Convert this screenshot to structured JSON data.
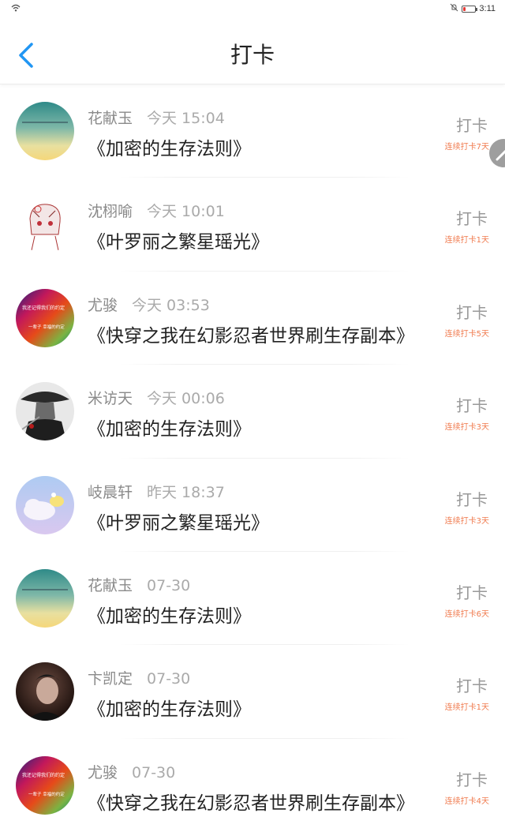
{
  "status_bar": {
    "time": "3:11"
  },
  "header": {
    "title": "打卡"
  },
  "items": [
    {
      "user": "花献玉",
      "time": "今天 15:04",
      "book": "《加密的生存法则》",
      "check_label": "打卡",
      "streak": "连续打卡7天",
      "avatar": "avatar-landscape-gradient"
    },
    {
      "user": "沈栩喻",
      "time": "今天 10:01",
      "book": "《叶罗丽之繁星瑶光》",
      "check_label": "打卡",
      "streak": "连续打卡1天",
      "avatar": "avatar-anime-sketch"
    },
    {
      "user": "尤骏",
      "time": "今天 03:53",
      "book": "《快穿之我在幻影忍者世界刷生存副本》",
      "check_label": "打卡",
      "streak": "连续打卡5天",
      "avatar": "avatar-rainbow-text"
    },
    {
      "user": "米访天",
      "time": "今天 00:06",
      "book": "《加密的生存法则》",
      "check_label": "打卡",
      "streak": "连续打卡3天",
      "avatar": "avatar-swordsman-bw"
    },
    {
      "user": "岐晨轩",
      "time": "昨天 18:37",
      "book": "《叶罗丽之繁星瑶光》",
      "check_label": "打卡",
      "streak": "连续打卡3天",
      "avatar": "avatar-cloud-cartoon"
    },
    {
      "user": "花献玉",
      "time": "07-30",
      "book": "《加密的生存法则》",
      "check_label": "打卡",
      "streak": "连续打卡6天",
      "avatar": "avatar-landscape-gradient"
    },
    {
      "user": "卞凯定",
      "time": "07-30",
      "book": "《加密的生存法则》",
      "check_label": "打卡",
      "streak": "连续打卡1天",
      "avatar": "avatar-dark-portrait"
    },
    {
      "user": "尤骏",
      "time": "07-30",
      "book": "《快穿之我在幻影忍者世界刷生存副本》",
      "check_label": "打卡",
      "streak": "连续打卡4天",
      "avatar": "avatar-rainbow-text"
    }
  ],
  "avatar_texts": {
    "rainbow_line1": "我还记得我们的约定",
    "rainbow_line2": "一辈子 幸福的约定"
  },
  "colors": {
    "accent": "#2196F3",
    "streak": "#F07B4F",
    "battery_low": "#E53935"
  }
}
